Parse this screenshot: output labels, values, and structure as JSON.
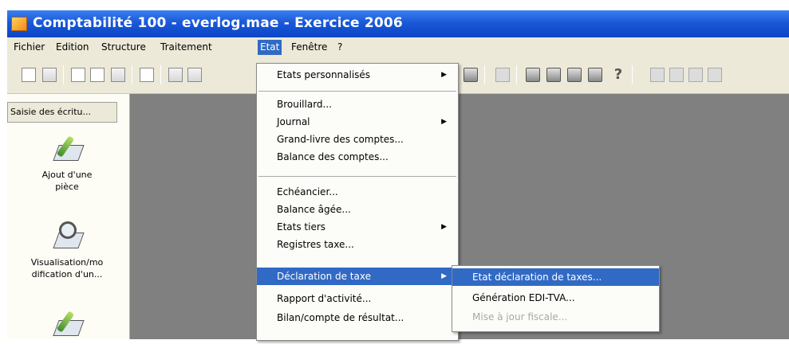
{
  "window": {
    "title": "Comptabilité 100 - everlog.mae - Exercice 2006"
  },
  "menubar": {
    "items": [
      "Fichier",
      "Edition",
      "Structure",
      "Traitement",
      "Etat",
      "Fenêtre",
      "?"
    ],
    "active": "Etat"
  },
  "toolbar": {
    "help_glyph": "?"
  },
  "sidebar": {
    "header": "Saisie des écritu...",
    "items": [
      {
        "label_line1": "Ajout d'une",
        "label_line2": "pièce",
        "icon": "pencil-tray-icon"
      },
      {
        "label_line1": "Visualisation/mo",
        "label_line2": "dification d'un...",
        "icon": "magnifier-tray-icon"
      },
      {
        "label_line1": "",
        "label_line2": "",
        "icon": "pencil-tray-icon"
      }
    ]
  },
  "etat_menu": {
    "items": [
      {
        "label": "Etats personnalisés",
        "submenu": true
      },
      {
        "label": "Brouillard..."
      },
      {
        "label": "Journal",
        "submenu": true
      },
      {
        "label": "Grand-livre des comptes..."
      },
      {
        "label": "Balance des comptes..."
      },
      {
        "label": "Echéancier..."
      },
      {
        "label": "Balance âgée..."
      },
      {
        "label": "Etats tiers",
        "submenu": true
      },
      {
        "label": "Registres taxe..."
      },
      {
        "label": "Déclaration de taxe",
        "submenu": true,
        "highlighted": true
      },
      {
        "label": "Rapport d'activité..."
      },
      {
        "label": "Bilan/compte de résultat..."
      }
    ]
  },
  "taxe_submenu": {
    "items": [
      {
        "label": "Etat déclaration de taxes...",
        "highlighted": true
      },
      {
        "label": "Génération EDI-TVA..."
      },
      {
        "label": "Mise à jour fiscale...",
        "disabled": true
      }
    ]
  },
  "colors": {
    "highlight": "#316ac5",
    "titlebar": "#0a46c6",
    "mdi_background": "#808080"
  }
}
